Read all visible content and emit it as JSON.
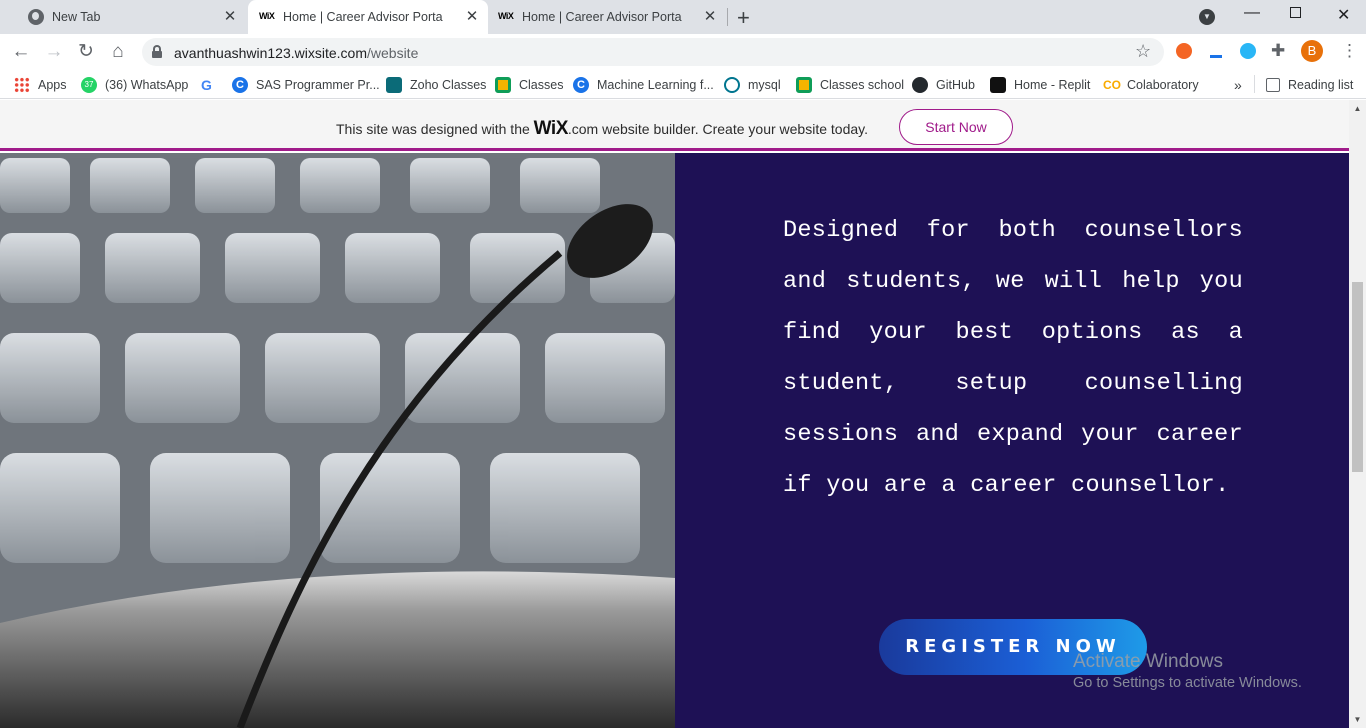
{
  "tabs": [
    {
      "title": "New Tab"
    },
    {
      "title": "Home | Career Advisor Porta",
      "favicon": "WiX"
    },
    {
      "title": "Home | Career Advisor Porta",
      "favicon": "WiX"
    }
  ],
  "toolbar": {
    "url_host": "avanthuashwin123.wixsite.com",
    "url_path": "/website",
    "profile_initial": "B"
  },
  "bookmarks": [
    {
      "label": "Apps",
      "icon": "apps-grid-icon",
      "color": "#ea4335"
    },
    {
      "label": "(36) WhatsApp",
      "icon": "whatsapp-icon",
      "color": "#25d366",
      "badge": "37"
    },
    {
      "label": "",
      "icon": "google-icon",
      "color": "#4285f4"
    },
    {
      "label": "SAS Programmer Pr...",
      "icon": "c-icon",
      "color": "#1a73e8"
    },
    {
      "label": "Zoho Classes",
      "icon": "zoho-icon",
      "color": "#0b6b78"
    },
    {
      "label": "Classes",
      "icon": "classroom-icon",
      "color": "#f4b400"
    },
    {
      "label": "Machine Learning f...",
      "icon": "c-icon",
      "color": "#1a73e8"
    },
    {
      "label": "mysql",
      "icon": "mysql-icon",
      "color": "#00758f"
    },
    {
      "label": "Classes school",
      "icon": "classroom-icon",
      "color": "#f4b400"
    },
    {
      "label": "GitHub",
      "icon": "github-icon",
      "color": "#24292e"
    },
    {
      "label": "Home - Replit",
      "icon": "replit-icon",
      "color": "#111111"
    },
    {
      "label": "Colaboratory",
      "icon": "colab-icon",
      "color": "#f9ab00"
    }
  ],
  "reading_list": "Reading list",
  "overflow": "»",
  "wix_banner": {
    "text_before": "This site was designed with the ",
    "brand": "WiX",
    "text_after": ".com website builder. Create your website today.",
    "button": "Start Now",
    "accent": "#a01b8a"
  },
  "hero": {
    "paragraph": "Designed for both counsellors and students, we will help you find your best options as a student, setup counselling sessions and expand your career if you are a career counsellor.",
    "register_button": "REGISTER NOW",
    "panel_color": "#1e1155"
  },
  "watermark": {
    "line1": "Activate Windows",
    "line2": "Go to Settings to activate Windows."
  }
}
